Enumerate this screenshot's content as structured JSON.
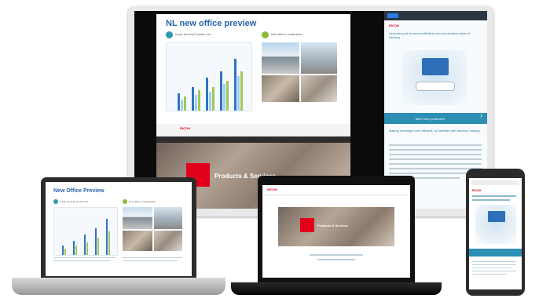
{
  "monitor": {
    "slide_title": "NL new office preview",
    "section_left": "5 year trend by Products Line",
    "section_right": "New office in construction",
    "hero_label": "Products & Services",
    "brand": "RICOH",
    "side_headline": "Verhuizing tot de meest efficiënte and productieve wijze of werking",
    "side_cta": "Meer over producten",
    "side_subhead": "Making meetings more efficient, by facilitate with decision making"
  },
  "laptop_left": {
    "slide_title": "New Office Preview",
    "section_left": "5 year trend by product line",
    "section_right": "New office in construction"
  },
  "laptop_right": {
    "brand": "RICOH",
    "hero_label": "Products & Services"
  },
  "phone": {
    "brand": "RICOH"
  },
  "colors": {
    "accent_blue": "#2a63ad",
    "brand_red": "#e3001b",
    "teal": "#2d8fb3"
  }
}
